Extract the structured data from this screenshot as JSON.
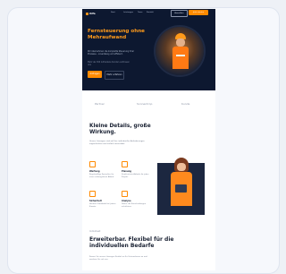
{
  "hero": {
    "logo": "Aifa",
    "nav": [
      "Start",
      "Leistungen",
      "Team",
      "Kontakt"
    ],
    "login": "Anmelden",
    "cta_small": "Jetzt starten",
    "title": "Fernsteuerung ohne Mehraufwand",
    "subtitle": "Wir übernehmen die komplette Steuerung Ihrer Prozesse – zuverlässig und effizient.",
    "small": "Mehr als 300 zufriedene Kunden vertrauen uns",
    "cta_primary": "Anfragen",
    "cta_secondary": "Mehr erfahren"
  },
  "logos": [
    "Partner",
    "Sonnentrop",
    "Kunde"
  ],
  "section2": {
    "title": "Kleine Details, große Wirkung.",
    "text": "Unsere Lösungen sind auf Ihre individuellen Anforderungen zugeschnitten und einfach umsetzbar.",
    "features": [
      {
        "icon": "tool-icon",
        "title": "Wartung",
        "desc": "Regelmäßige Kontrollen für einen reibungslosen Ablauf."
      },
      {
        "icon": "doc-icon",
        "title": "Planung",
        "desc": "Strukturierte Abläufe für jedes Projekt."
      },
      {
        "icon": "shield-icon",
        "title": "Sicherheit",
        "desc": "Höchste Standards bei jedem Einsatz."
      },
      {
        "icon": "chart-icon",
        "title": "Analyse",
        "desc": "Daten, die Entscheidungen erleichtern."
      }
    ]
  },
  "section3": {
    "kicker": "Individuell",
    "title": "Erweiterbar. Flexibel für die individuellen Bedarfe",
    "text": "Passen Sie unsere Lösungen flexibel an Ihr Unternehmen an und wachsen Sie mit uns."
  },
  "colors": {
    "accent": "#ff8a00",
    "dark": "#0d1830"
  }
}
